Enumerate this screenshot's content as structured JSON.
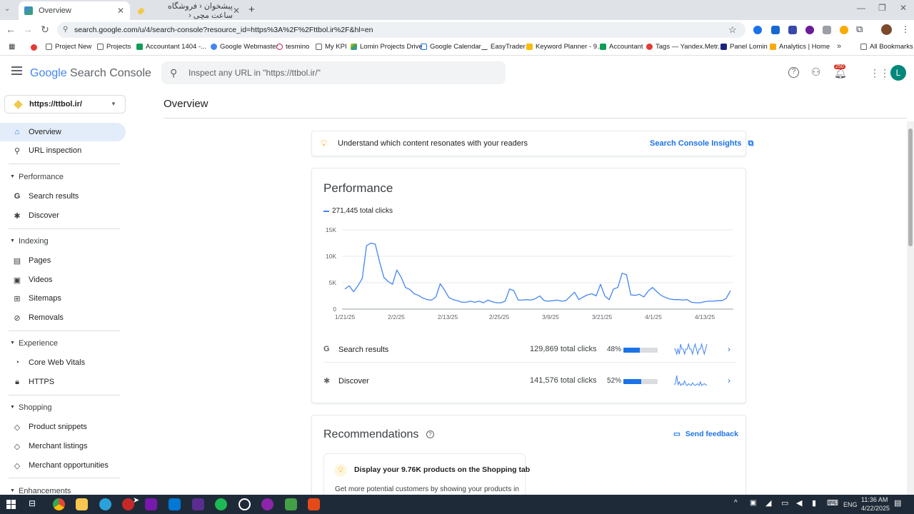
{
  "browser": {
    "tabs": [
      {
        "label": "Overview",
        "active": true
      },
      {
        "label": "پیشخوان ‹ فروشگاه ساعت مچی ‹",
        "active": false
      }
    ],
    "url": "search.google.com/u/4/search-console?resource_id=https%3A%2F%2Fttbol.ir%2F&hl=en",
    "bookmarks": [
      "Project New",
      "Projects",
      "Accountant 1404 -...",
      "Google Webmaster",
      "tesmino",
      "My KPI",
      "Lomin Projects Drive",
      "Google Calendar",
      "EasyTrader",
      "Keyword Planner - 9...",
      "Accountant",
      "Tags — Yandex.Metr...",
      "Panel Lomin",
      "Analytics | Home"
    ],
    "all_bookmarks": "All Bookmarks"
  },
  "header": {
    "product_google": "Google",
    "product_name": "Search Console",
    "search_placeholder": "Inspect any URL in \"https://ttbol.ir/\"",
    "notif_count": "250",
    "avatar_letter": "L"
  },
  "sidebar": {
    "property": "https://ttbol.ir/",
    "overview": "Overview",
    "url_inspection": "URL inspection",
    "performance": "Performance",
    "search_results": "Search results",
    "discover": "Discover",
    "indexing": "Indexing",
    "pages": "Pages",
    "videos": "Videos",
    "sitemaps": "Sitemaps",
    "removals": "Removals",
    "experience": "Experience",
    "core_web_vitals": "Core Web Vitals",
    "https": "HTTPS",
    "shopping": "Shopping",
    "product_snippets": "Product snippets",
    "merchant_listings": "Merchant listings",
    "merchant_opportunities": "Merchant opportunities",
    "enhancements": "Enhancements"
  },
  "main": {
    "page_title": "Overview",
    "insights_text": "Understand which content resonates with your readers",
    "insights_link": "Search Console Insights",
    "performance_title": "Performance",
    "legend": "271,445 total clicks",
    "rows": [
      {
        "name": "Search results",
        "clicks": "129,869 total clicks",
        "pct": "48%",
        "share": 0.48
      },
      {
        "name": "Discover",
        "clicks": "141,576 total clicks",
        "pct": "52%",
        "share": 0.52
      }
    ],
    "recommendations_title": "Recommendations",
    "send_feedback": "Send feedback",
    "rec_title": "Display your 9.76K products on the Shopping tab",
    "rec_text": "Get more potential customers by showing your products in"
  },
  "chart_data": {
    "type": "line",
    "series": [
      {
        "name": "271,445 total clicks",
        "color": "#4285f4",
        "values": [
          3800,
          4400,
          3300,
          4400,
          5800,
          12000,
          12500,
          12300,
          9000,
          6000,
          5200,
          4700,
          7400,
          6000,
          4100,
          3700,
          2900,
          2600,
          2100,
          1800,
          1700,
          2300,
          4800,
          3600,
          2200,
          1800,
          1600,
          1300,
          1300,
          1500,
          1300,
          1500,
          1200,
          1700,
          1400,
          1200,
          1200,
          1500,
          3800,
          3500,
          1700,
          1700,
          1800,
          1700,
          2000,
          2500,
          1600,
          1500,
          1600,
          1700,
          1500,
          1600,
          2400,
          3200,
          1800,
          2300,
          2700,
          2900,
          2500,
          4700,
          2500,
          1800,
          3800,
          4100,
          6800,
          6500,
          2700,
          2600,
          2800,
          2300,
          3400,
          4100,
          3300,
          2600,
          2200,
          1900,
          1800,
          1800,
          1700,
          1800,
          1300,
          1200,
          1200,
          1400,
          1500,
          1500,
          1600,
          1600,
          2000,
          3500
        ]
      }
    ],
    "x_tick_labels": [
      "1/21/25",
      "2/2/25",
      "2/13/25",
      "2/25/25",
      "3/9/25",
      "3/21/25",
      "4/1/25",
      "4/13/25"
    ],
    "y_tick_labels": [
      "0",
      "5K",
      "10K",
      "15K"
    ],
    "ylim": [
      0,
      15000
    ],
    "grid": true,
    "sparklines": [
      {
        "name": "Search results",
        "values": [
          6,
          6,
          5,
          6,
          5,
          7,
          6,
          6,
          5,
          6,
          6,
          7,
          6,
          6,
          5,
          6,
          7,
          6,
          5,
          6,
          6,
          7,
          6,
          5,
          6,
          7
        ]
      },
      {
        "name": "Discover",
        "values": [
          2,
          3,
          12,
          2,
          5,
          1,
          3,
          2,
          6,
          2,
          1,
          3,
          2,
          1,
          4,
          2,
          1,
          2,
          3,
          1,
          5,
          1,
          2,
          3,
          2,
          1
        ]
      }
    ]
  },
  "taskbar": {
    "time": "11:36 AM",
    "date": "4/22/2025",
    "lang": "ENG"
  }
}
